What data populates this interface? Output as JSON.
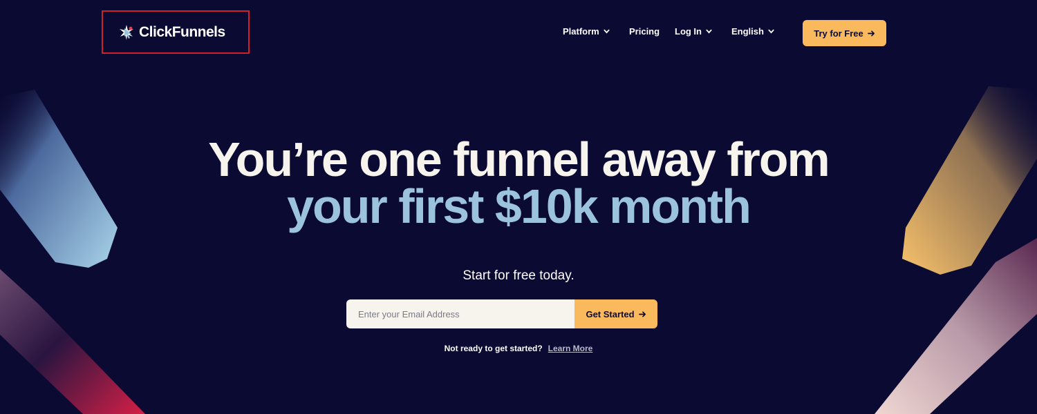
{
  "brand": {
    "name": "ClickFunnels"
  },
  "nav": {
    "items": [
      {
        "label": "Platform",
        "has_dropdown": true
      },
      {
        "label": "Pricing",
        "has_dropdown": false
      },
      {
        "label": "Log In",
        "has_dropdown": true
      },
      {
        "label": "English",
        "has_dropdown": true
      }
    ],
    "cta_label": "Try for Free"
  },
  "hero": {
    "headline_line1": "You’re one funnel away from",
    "headline_line2": "your first $10k month",
    "subheading": "Start for free today."
  },
  "signup": {
    "email_placeholder": "Enter your Email Address",
    "email_value": "",
    "button_label": "Get Started"
  },
  "footer_prompt": {
    "text": "Not ready to get started?",
    "link_label": "Learn More"
  },
  "colors": {
    "background": "#0b0a33",
    "accent": "#f9b95c",
    "headline_secondary": "#9cc3de",
    "logo_highlight_border": "#d0202a"
  },
  "icons": [
    "logo-mark-icon",
    "chevron-down-icon",
    "arrow-right-icon"
  ]
}
